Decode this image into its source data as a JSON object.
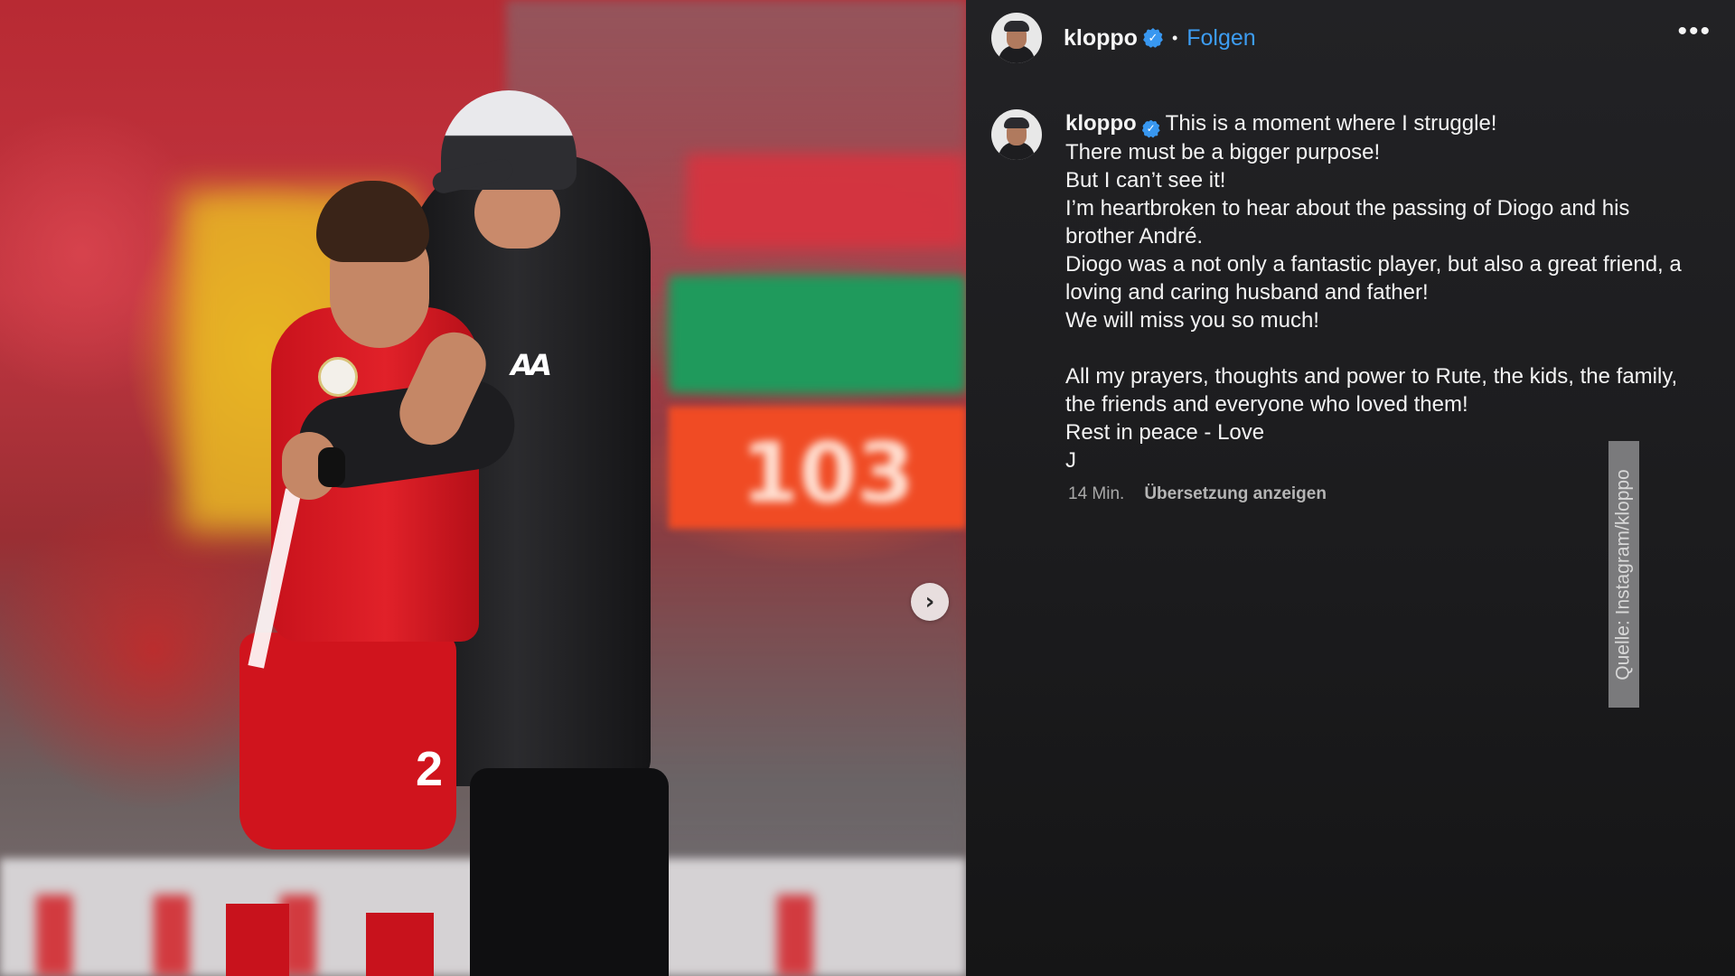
{
  "photo": {
    "scoreboard_text": "103",
    "shorts_number": "2",
    "jacket_logo": "AA",
    "next_button_icon": "chevron-right-icon",
    "next_button_glyph": "›"
  },
  "post": {
    "header": {
      "username": "kloppo",
      "verified": true,
      "separator": "•",
      "follow_label": "Folgen",
      "more_icon": "more-horizontal-icon",
      "more_glyph": "•••"
    },
    "caption": {
      "username": "kloppo",
      "lines": [
        "This is a moment where I struggle!",
        "There must be a bigger purpose!",
        "But I can’t see it!",
        "I’m heartbroken to hear about the passing of Diogo and his",
        "brother André.",
        "Diogo was a not only a fantastic player, but also a great friend, a",
        "loving and caring husband and father!",
        "We will miss you so much!",
        "",
        "All my prayers, thoughts and power to Rute, the kids, the family,",
        "the friends and everyone who loved them!",
        "Rest in peace - Love",
        "J"
      ]
    },
    "meta": {
      "time": "14 Min.",
      "translate_label": "Übersetzung anzeigen"
    }
  },
  "source_credit": "Quelle: Instagram/kloppo",
  "colors": {
    "panel_bg": "#1b1b1d",
    "link_blue": "#3d9df2",
    "verified_blue": "#3897f0"
  }
}
